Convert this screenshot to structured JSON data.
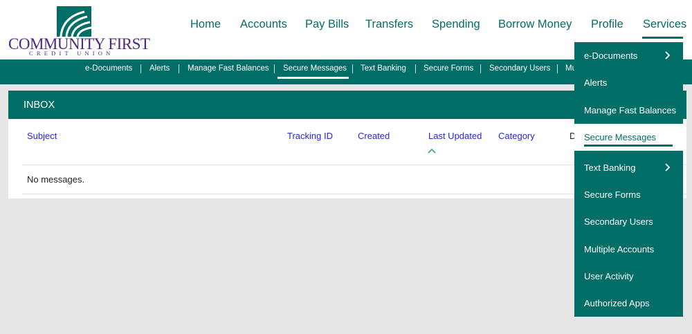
{
  "brand": {
    "name": "COMMUNITY FIRST",
    "sub": "CREDIT UNION",
    "color": "#4b2a7b",
    "accent": "#006e66"
  },
  "nav": {
    "home": "Home",
    "accounts": "Accounts",
    "pay_bills": "Pay Bills",
    "transfers": "Transfers",
    "spending": "Spending",
    "borrow": "Borrow Money",
    "profile": "Profile",
    "services": "Services"
  },
  "subnav": {
    "edocs": "e-Documents",
    "alerts": "Alerts",
    "fast_balances": "Manage Fast Balances",
    "secure_messages": "Secure Messages",
    "text_banking": "Text Banking",
    "secure_forms": "Secure Forms",
    "secondary_users": "Secondary Users",
    "more": "Mu"
  },
  "inbox": {
    "title": "INBOX",
    "columns": {
      "subject": "Subject",
      "tracking": "Tracking ID",
      "created": "Created",
      "updated": "Last Updated",
      "category": "Category",
      "cut": "D"
    },
    "empty": "No messages."
  },
  "menu": {
    "edocs": "e-Documents",
    "alerts": "Alerts",
    "fast_balances": "Manage Fast Balances",
    "secure_messages": "Secure Messages",
    "text_banking": "Text Banking",
    "secure_forms": "Secure Forms",
    "secondary_users": "Secondary Users",
    "multiple_accounts": "Multiple Accounts",
    "user_activity": "User Activity",
    "authorized_apps": "Authorized Apps"
  },
  "icons": {
    "sort": "chevron-up-icon",
    "submenu": "chevron-right-icon"
  }
}
